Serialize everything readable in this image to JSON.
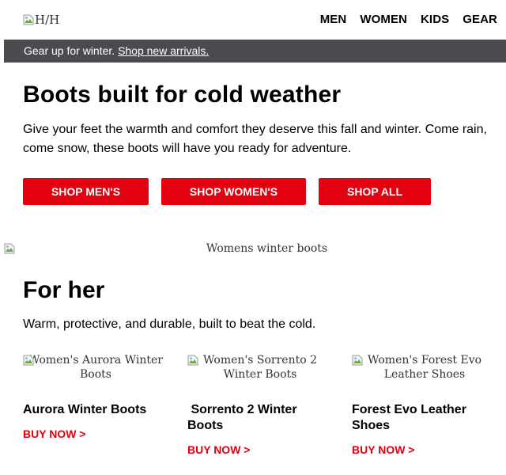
{
  "header": {
    "logo_alt": "H/H",
    "nav": [
      "MEN",
      "WOMEN",
      "KIDS",
      "GEAR"
    ]
  },
  "banner": {
    "text": "Gear up for winter.",
    "link": "Shop new arrivals."
  },
  "hero": {
    "title": "Boots built for cold weather",
    "text": "Give your feet the warmth and comfort they deserve this fall and winter. Come rain, come snow, these boots will have you ready for adventure.",
    "buttons": [
      "SHOP MEN'S",
      "SHOP WOMEN'S",
      "SHOP ALL"
    ],
    "image_alt": "Womens winter boots"
  },
  "section": {
    "title": "For her",
    "text": "Warm, protective, and durable, built to beat the cold.",
    "products": [
      {
        "image_alt": "Women's Aurora Winter Boots",
        "name": "Aurora Winter Boots",
        "cta": "BUY NOW >"
      },
      {
        "image_alt": "Women's Sorrento 2 Winter Boots",
        "name": " Sorrento 2 Winter Boots",
        "cta": "BUY NOW >"
      },
      {
        "image_alt": "Women's Forest Evo Leather Shoes",
        "name": "Forest Evo Leather Shoes",
        "cta": "BUY NOW >"
      }
    ]
  },
  "colors": {
    "accent_red": "#e3000f",
    "banner_bg": "#4a4a4f"
  }
}
